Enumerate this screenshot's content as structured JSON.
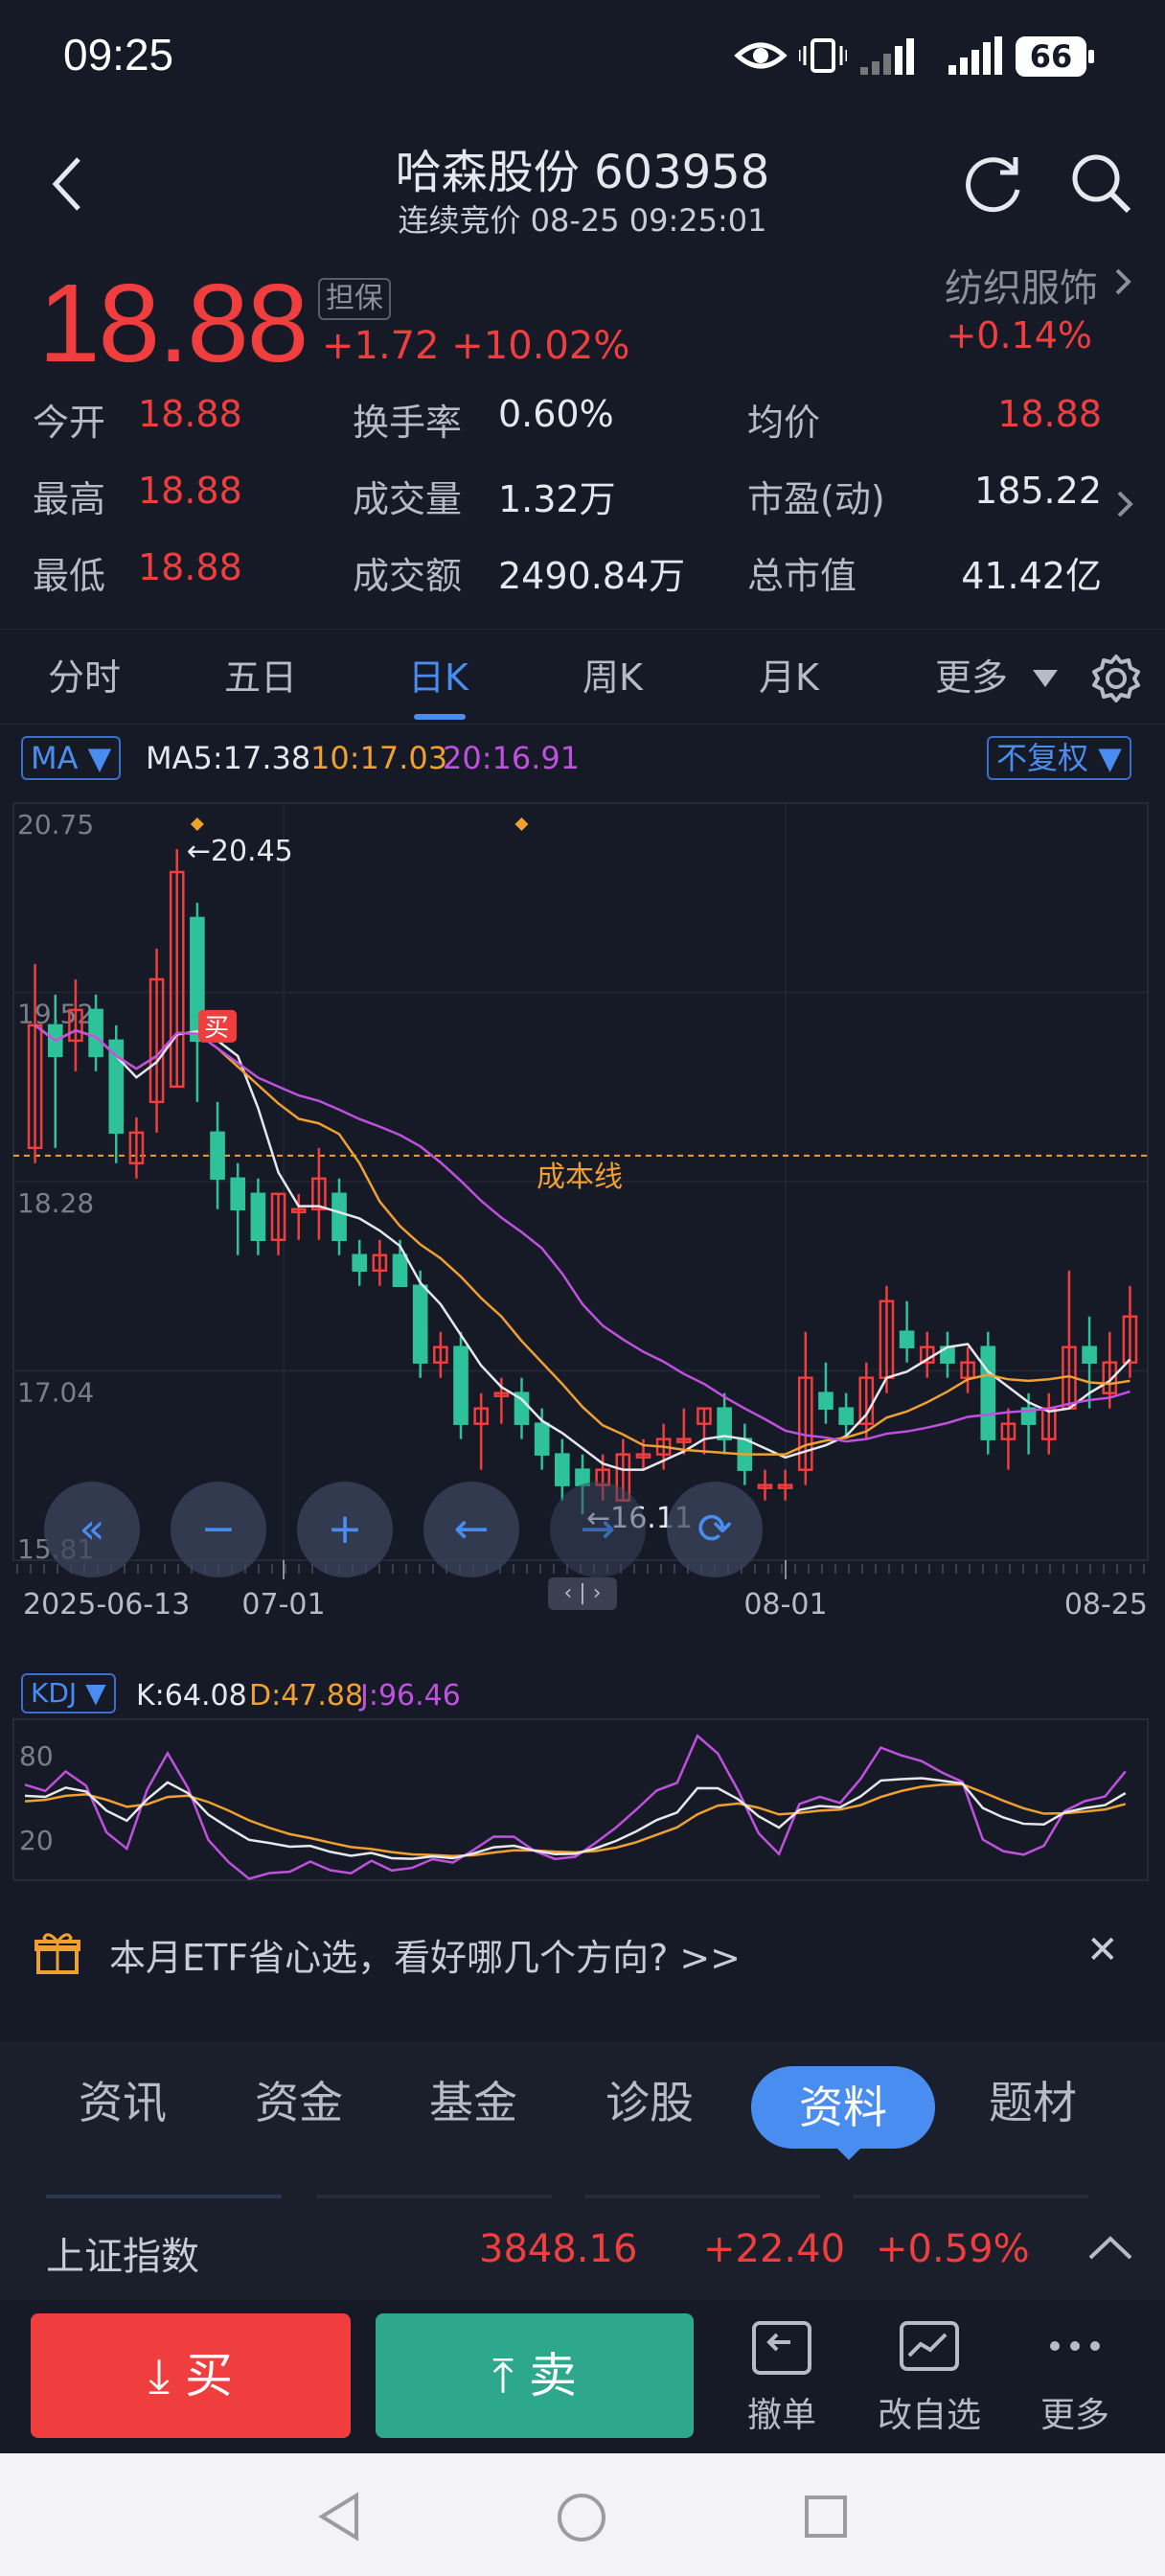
{
  "status_bar": {
    "time": "09:25",
    "battery": "66"
  },
  "header": {
    "title": "哈森股份 603958",
    "subtitle": "连续竞价 08-25 09:25:01"
  },
  "quote": {
    "price": "18.88",
    "badge": "担保",
    "change": "+1.72 +10.02%",
    "sector": "纺织服饰",
    "sector_change": "+0.14%"
  },
  "stats": [
    {
      "label": "今开",
      "value": "18.88",
      "color": "#f03e3e"
    },
    {
      "label": "换手率",
      "value": "0.60%",
      "color": "#e6e8ee"
    },
    {
      "label": "均价",
      "value": "18.88",
      "color": "#f03e3e"
    },
    {
      "label": "最高",
      "value": "18.88",
      "color": "#f03e3e"
    },
    {
      "label": "成交量",
      "value": "1.32万",
      "color": "#e6e8ee"
    },
    {
      "label": "市盈(动)",
      "value": "185.22",
      "color": "#e6e8ee"
    },
    {
      "label": "最低",
      "value": "18.88",
      "color": "#f03e3e"
    },
    {
      "label": "成交额",
      "value": "2490.84万",
      "color": "#e6e8ee"
    },
    {
      "label": "总市值",
      "value": "41.42亿",
      "color": "#e6e8ee"
    }
  ],
  "period_tabs": {
    "t0": "分时",
    "t1": "五日",
    "t2": "日K",
    "t3": "周K",
    "t4": "月K",
    "t5": "更多"
  },
  "chart_controls": {
    "ma_button": "MA",
    "ma5": "MA5:17.38",
    "ma10": "10:17.03",
    "ma20": "20:16.91",
    "adjust_button": "不复权",
    "cost_line_label": "成本线",
    "buy_marker": "买",
    "high_annot": "←20.45",
    "low_annot": "←16.11",
    "kdj_button": "KDJ",
    "k": "K:64.08",
    "d": "D:47.88",
    "j": "J:96.46"
  },
  "chart_data": [
    {
      "type": "candlestick",
      "ylim": [
        15.81,
        20.75
      ],
      "y_ticks": [
        "20.75",
        "19.52",
        "18.28",
        "17.04",
        "15.81"
      ],
      "x_ticks": [
        "2025-06-13",
        "07-01",
        "08-01",
        "08-25"
      ],
      "cost_line": 18.45,
      "max_annotation": 20.45,
      "min_annotation": 16.11,
      "candles": [
        {
          "o": 18.5,
          "h": 19.7,
          "l": 18.4,
          "c": 19.3
        },
        {
          "o": 19.3,
          "h": 19.5,
          "l": 18.5,
          "c": 19.1
        },
        {
          "o": 19.2,
          "h": 19.6,
          "l": 19.0,
          "c": 19.4
        },
        {
          "o": 19.4,
          "h": 19.5,
          "l": 19.0,
          "c": 19.1
        },
        {
          "o": 19.2,
          "h": 19.3,
          "l": 18.4,
          "c": 18.6
        },
        {
          "o": 18.4,
          "h": 18.7,
          "l": 18.3,
          "c": 18.6
        },
        {
          "o": 18.8,
          "h": 19.8,
          "l": 18.6,
          "c": 19.6
        },
        {
          "o": 18.9,
          "h": 20.45,
          "l": 18.9,
          "c": 20.3
        },
        {
          "o": 20.0,
          "h": 20.1,
          "l": 18.8,
          "c": 19.2
        },
        {
          "o": 18.6,
          "h": 18.8,
          "l": 18.1,
          "c": 18.3
        },
        {
          "o": 18.3,
          "h": 18.4,
          "l": 17.8,
          "c": 18.1
        },
        {
          "o": 18.2,
          "h": 18.3,
          "l": 17.8,
          "c": 17.9
        },
        {
          "o": 17.9,
          "h": 18.2,
          "l": 17.8,
          "c": 18.2
        },
        {
          "o": 18.1,
          "h": 18.2,
          "l": 17.9,
          "c": 18.1
        },
        {
          "o": 18.1,
          "h": 18.5,
          "l": 17.9,
          "c": 18.3
        },
        {
          "o": 18.2,
          "h": 18.3,
          "l": 17.8,
          "c": 17.9
        },
        {
          "o": 17.8,
          "h": 17.9,
          "l": 17.6,
          "c": 17.7
        },
        {
          "o": 17.7,
          "h": 17.9,
          "l": 17.6,
          "c": 17.8
        },
        {
          "o": 17.8,
          "h": 17.9,
          "l": 17.6,
          "c": 17.6
        },
        {
          "o": 17.6,
          "h": 17.7,
          "l": 17.0,
          "c": 17.1
        },
        {
          "o": 17.1,
          "h": 17.3,
          "l": 17.0,
          "c": 17.2
        },
        {
          "o": 17.2,
          "h": 17.3,
          "l": 16.6,
          "c": 16.7
        },
        {
          "o": 16.7,
          "h": 16.9,
          "l": 16.4,
          "c": 16.8
        },
        {
          "o": 16.9,
          "h": 17.0,
          "l": 16.7,
          "c": 16.9
        },
        {
          "o": 16.9,
          "h": 17.0,
          "l": 16.6,
          "c": 16.7
        },
        {
          "o": 16.7,
          "h": 16.8,
          "l": 16.4,
          "c": 16.5
        },
        {
          "o": 16.5,
          "h": 16.6,
          "l": 16.2,
          "c": 16.3
        },
        {
          "o": 16.4,
          "h": 16.5,
          "l": 16.11,
          "c": 16.3
        },
        {
          "o": 16.3,
          "h": 16.5,
          "l": 16.2,
          "c": 16.4
        },
        {
          "o": 16.2,
          "h": 16.6,
          "l": 16.2,
          "c": 16.5
        },
        {
          "o": 16.5,
          "h": 16.6,
          "l": 16.4,
          "c": 16.5
        },
        {
          "o": 16.5,
          "h": 16.7,
          "l": 16.4,
          "c": 16.6
        },
        {
          "o": 16.6,
          "h": 16.8,
          "l": 16.5,
          "c": 16.6
        },
        {
          "o": 16.7,
          "h": 16.8,
          "l": 16.5,
          "c": 16.8
        },
        {
          "o": 16.8,
          "h": 16.9,
          "l": 16.5,
          "c": 16.6
        },
        {
          "o": 16.6,
          "h": 16.7,
          "l": 16.3,
          "c": 16.4
        },
        {
          "o": 16.3,
          "h": 16.4,
          "l": 16.2,
          "c": 16.3
        },
        {
          "o": 16.3,
          "h": 16.4,
          "l": 16.2,
          "c": 16.3
        },
        {
          "o": 16.4,
          "h": 17.3,
          "l": 16.3,
          "c": 17.0
        },
        {
          "o": 16.9,
          "h": 17.1,
          "l": 16.7,
          "c": 16.8
        },
        {
          "o": 16.8,
          "h": 16.9,
          "l": 16.6,
          "c": 16.7
        },
        {
          "o": 16.7,
          "h": 17.1,
          "l": 16.6,
          "c": 17.0
        },
        {
          "o": 17.0,
          "h": 17.6,
          "l": 16.9,
          "c": 17.5
        },
        {
          "o": 17.3,
          "h": 17.5,
          "l": 17.1,
          "c": 17.2
        },
        {
          "o": 17.1,
          "h": 17.3,
          "l": 17.0,
          "c": 17.2
        },
        {
          "o": 17.2,
          "h": 17.3,
          "l": 17.0,
          "c": 17.1
        },
        {
          "o": 17.0,
          "h": 17.2,
          "l": 16.9,
          "c": 17.1
        },
        {
          "o": 17.2,
          "h": 17.3,
          "l": 16.5,
          "c": 16.6
        },
        {
          "o": 16.6,
          "h": 16.8,
          "l": 16.4,
          "c": 16.7
        },
        {
          "o": 16.8,
          "h": 16.9,
          "l": 16.5,
          "c": 16.7
        },
        {
          "o": 16.6,
          "h": 16.9,
          "l": 16.5,
          "c": 16.8
        },
        {
          "o": 16.8,
          "h": 17.7,
          "l": 16.8,
          "c": 17.2
        },
        {
          "o": 17.2,
          "h": 17.4,
          "l": 16.8,
          "c": 17.1
        },
        {
          "o": 16.9,
          "h": 17.3,
          "l": 16.8,
          "c": 17.1
        },
        {
          "o": 17.1,
          "h": 17.6,
          "l": 17.0,
          "c": 17.4
        }
      ]
    },
    {
      "type": "line",
      "title": "KDJ",
      "y_ticks": [
        "80",
        "20"
      ]
    }
  ],
  "banner": {
    "text": "本月ETF省心选，看好哪几个方向? >>"
  },
  "lower_tabs": {
    "t0": "资讯",
    "t1": "资金",
    "t2": "基金",
    "t3": "诊股",
    "t4": "资料",
    "t5": "题材"
  },
  "index_row": {
    "name": "上证指数",
    "value": "3848.16",
    "change": "+22.40",
    "pct": "+0.59%"
  },
  "footer": {
    "buy": "买",
    "sell": "卖",
    "cancel": "撤单",
    "edit_watch": "改自选",
    "more": "更多"
  }
}
